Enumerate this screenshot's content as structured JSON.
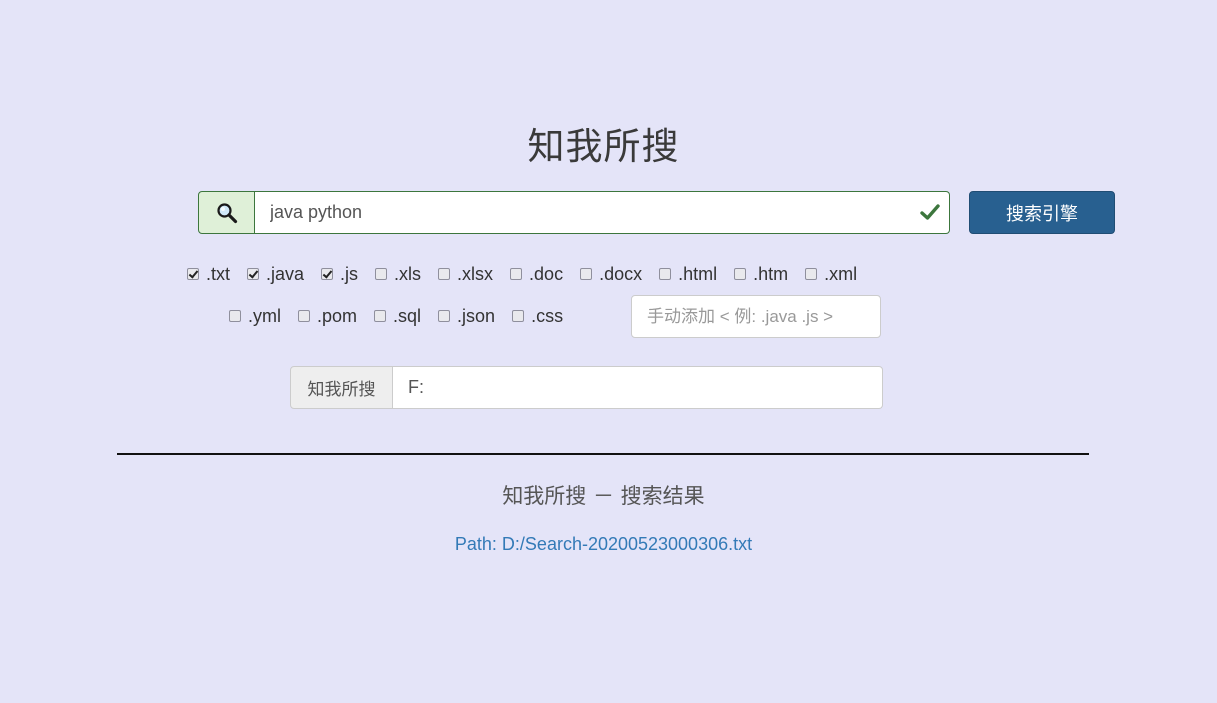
{
  "header": {
    "title": "知我所搜"
  },
  "search": {
    "icon": "search-icon",
    "value": "java python",
    "valid_icon": "check-icon",
    "button_label": "搜索引擎"
  },
  "extensions": {
    "row1": [
      {
        "label": ".txt",
        "checked": true
      },
      {
        "label": ".java",
        "checked": true
      },
      {
        "label": ".js",
        "checked": true
      },
      {
        "label": ".xls",
        "checked": false
      },
      {
        "label": ".xlsx",
        "checked": false
      },
      {
        "label": ".doc",
        "checked": false
      },
      {
        "label": ".docx",
        "checked": false
      },
      {
        "label": ".html",
        "checked": false
      },
      {
        "label": ".htm",
        "checked": false
      },
      {
        "label": ".xml",
        "checked": false
      }
    ],
    "row2": [
      {
        "label": ".yml",
        "checked": false
      },
      {
        "label": ".pom",
        "checked": false
      },
      {
        "label": ".sql",
        "checked": false
      },
      {
        "label": ".json",
        "checked": false
      },
      {
        "label": ".css",
        "checked": false
      }
    ],
    "custom_placeholder": "手动添加 < 例: .java .js >"
  },
  "path": {
    "addon_label": "知我所搜",
    "value": "F:"
  },
  "results": {
    "title": "知我所搜 － 搜索结果",
    "path_text": "Path: D:/Search-20200523000306.txt"
  },
  "colors": {
    "background": "#e4e4f8",
    "success_green": "#3c763d",
    "primary_button": "#286090",
    "link_blue": "#337ab7"
  }
}
